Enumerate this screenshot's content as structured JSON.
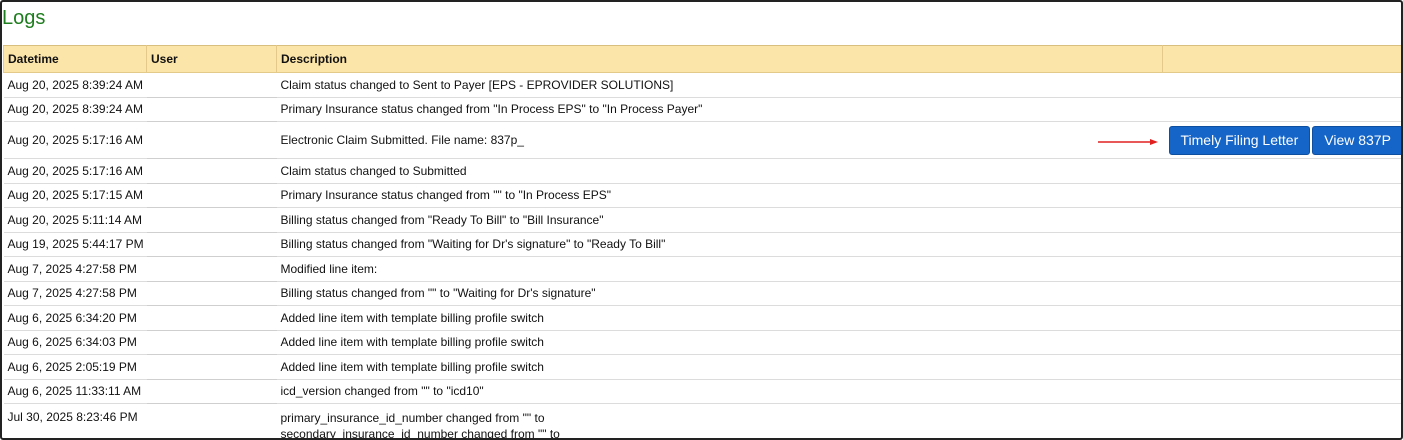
{
  "page": {
    "title": "Logs"
  },
  "table": {
    "headers": {
      "datetime": "Datetime",
      "user": "User",
      "description": "Description",
      "actions": ""
    },
    "rows": [
      {
        "datetime": "Aug 20, 2025 8:39:24 AM",
        "user": "",
        "description": "Claim status changed to Sent to Payer [EPS - EPROVIDER SOLUTIONS]"
      },
      {
        "datetime": "Aug 20, 2025 8:39:24 AM",
        "user": "",
        "description": "Primary Insurance status changed from \"In Process EPS\" to \"In Process Payer\""
      },
      {
        "datetime": "Aug 20, 2025 5:17:16 AM",
        "user": "",
        "description": "Electronic Claim Submitted. File name: 837p_",
        "timely_filing_label": "Timely Filing Letter",
        "view_837p_label": "View 837P"
      },
      {
        "datetime": "Aug 20, 2025 5:17:16 AM",
        "user": "",
        "description": "Claim status changed to Submitted"
      },
      {
        "datetime": "Aug 20, 2025 5:17:15 AM",
        "user": "",
        "description": "Primary Insurance status changed from \"\" to \"In Process EPS\""
      },
      {
        "datetime": "Aug 20, 2025 5:11:14 AM",
        "user": "",
        "description": "Billing status changed from \"Ready To Bill\" to \"Bill Insurance\""
      },
      {
        "datetime": "Aug 19, 2025 5:44:17 PM",
        "user": "",
        "description": "Billing status changed from \"Waiting for Dr's signature\" to \"Ready To Bill\""
      },
      {
        "datetime": "Aug 7, 2025 4:27:58 PM",
        "user": "",
        "description": "Modified line item:"
      },
      {
        "datetime": "Aug 7, 2025 4:27:58 PM",
        "user": "",
        "description": "Billing status changed from \"\" to \"Waiting for Dr's signature\""
      },
      {
        "datetime": "Aug 6, 2025 6:34:20 PM",
        "user": "",
        "description": "Added line item with template billing profile switch"
      },
      {
        "datetime": "Aug 6, 2025 6:34:03 PM",
        "user": "",
        "description": "Added line item with template billing profile switch"
      },
      {
        "datetime": "Aug 6, 2025 2:05:19 PM",
        "user": "",
        "description": "Added line item with template billing profile switch"
      },
      {
        "datetime": "Aug 6, 2025 11:33:11 AM",
        "user": "",
        "description": "icd_version changed from \"\" to \"icd10\""
      },
      {
        "datetime": "Jul 30, 2025 8:23:46 PM",
        "user": "",
        "description": "primary_insurance_id_number changed from \"\" to",
        "description_line2": "secondary_insurance_id_number changed from \"\" to"
      }
    ]
  },
  "colors": {
    "title": "#1e7d1e",
    "header_bg": "#fce5a8",
    "button_bg": "#1565c8",
    "arrow": "#e02020"
  },
  "icons": {
    "annotation_arrow": "right-arrow-icon"
  }
}
